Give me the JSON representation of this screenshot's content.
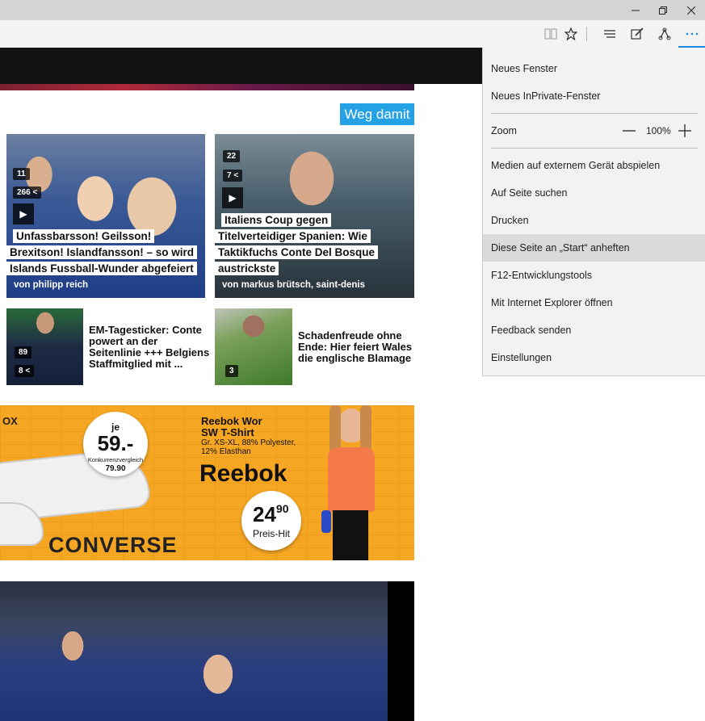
{
  "window": {
    "minimize_icon": "minimize-icon",
    "restore_icon": "restore-icon",
    "close_icon": "close-icon"
  },
  "toolbar": {
    "icons": [
      "reading-view-icon",
      "favorites-star-icon",
      "hub-icon",
      "web-note-icon",
      "share-icon",
      "more-icon"
    ]
  },
  "page": {
    "dismiss_label": "Weg damit",
    "articles": [
      {
        "caption_lines": [
          "Unfassbarsson! Geilsson!",
          "Brexitson! Islandfansson! – so wird",
          "Islands Fussball-Wunder abgefeiert"
        ],
        "author": "von philipp reich",
        "photos": "11",
        "shares": "266"
      },
      {
        "caption_lines": [
          "Italiens Coup gegen",
          "Titelverteidiger Spanien: Wie",
          "Taktikfuchs Conte Del Bosque",
          "austrickste"
        ],
        "author": "von markus brütsch, saint-denis",
        "photos": "22",
        "shares": "7"
      }
    ],
    "mini_articles": [
      {
        "title_lines": [
          "EM-Tagesticker: Conte",
          "powert an der",
          "Seitenlinie +++ Belgiens",
          "Staffmitglied mit ..."
        ],
        "comments": "89",
        "shares": "8"
      },
      {
        "title_lines": [
          "Schadenfreude ohne",
          "Ende: Hier feiert Wales",
          "die englische Blamage"
        ],
        "comments": "3"
      }
    ],
    "ad": {
      "left_text": "OX",
      "price_prefix": "je",
      "price": "59.-",
      "compare_label": "Konkurrenzvergleich",
      "compare_price": "79.90",
      "product_title": "Reebok Wor",
      "product_sub": "SW T-Shirt",
      "product_detail1": "Gr. XS-XL, 88% Polyester,",
      "product_detail2": "12% Elasthan",
      "brand_reebok": "Reebok",
      "brand_converse": "CONVERSE",
      "price2_main": "24",
      "price2_cents": "90",
      "price2_label": "Preis-Hit",
      "colors": {
        "background": "#f5a623"
      }
    }
  },
  "menu": {
    "new_window": "Neues Fenster",
    "new_inprivate": "Neues InPrivate-Fenster",
    "zoom_label": "Zoom",
    "zoom_value": "100%",
    "cast": "Medien auf externem Gerät abspielen",
    "find": "Auf Seite suchen",
    "print": "Drucken",
    "pin": "Diese Seite an „Start“ anheften",
    "devtools": "F12-Entwicklungstools",
    "open_ie": "Mit Internet Explorer öffnen",
    "feedback": "Feedback senden",
    "settings": "Einstellungen"
  },
  "colors": {
    "accent": "#1e88d6",
    "dismiss_button": "#25a2e6"
  }
}
